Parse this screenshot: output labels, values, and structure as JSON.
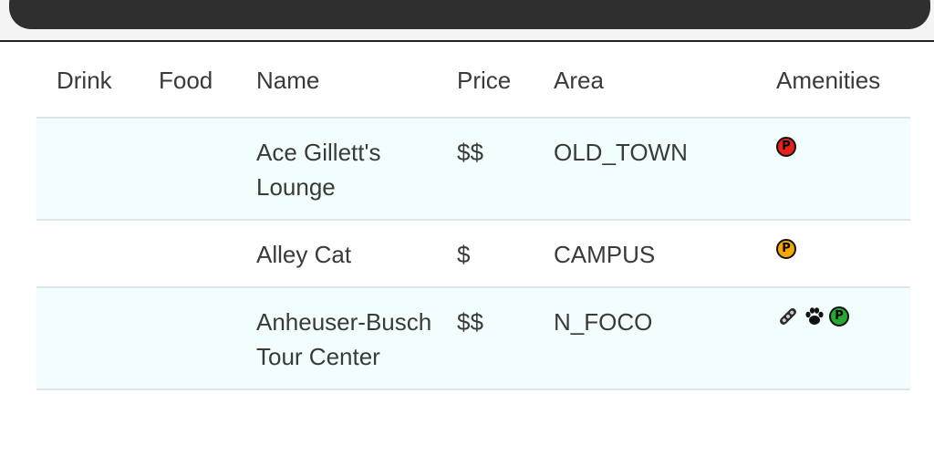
{
  "table": {
    "headers": {
      "drink": "Drink",
      "food": "Food",
      "name": "Name",
      "price": "Price",
      "area": "Area",
      "amenities": "Amenities"
    },
    "rows": [
      {
        "name": "Ace Gillett's Lounge",
        "price": "$$",
        "area": "OLD_TOWN",
        "amenities": [
          {
            "icon": "parking-icon",
            "letter": "P",
            "color": "#e62117"
          }
        ]
      },
      {
        "name": "Alley Cat",
        "price": "$",
        "area": "CAMPUS",
        "amenities": [
          {
            "icon": "parking-icon",
            "letter": "P",
            "color": "#f5a800"
          }
        ]
      },
      {
        "name": "Anheuser-Busch Tour Center",
        "price": "$$",
        "area": "N_FOCO",
        "amenities": [
          {
            "icon": "bike-chain-icon"
          },
          {
            "icon": "paw-icon"
          },
          {
            "icon": "parking-icon",
            "letter": "P",
            "color": "#27a833"
          }
        ]
      }
    ]
  }
}
